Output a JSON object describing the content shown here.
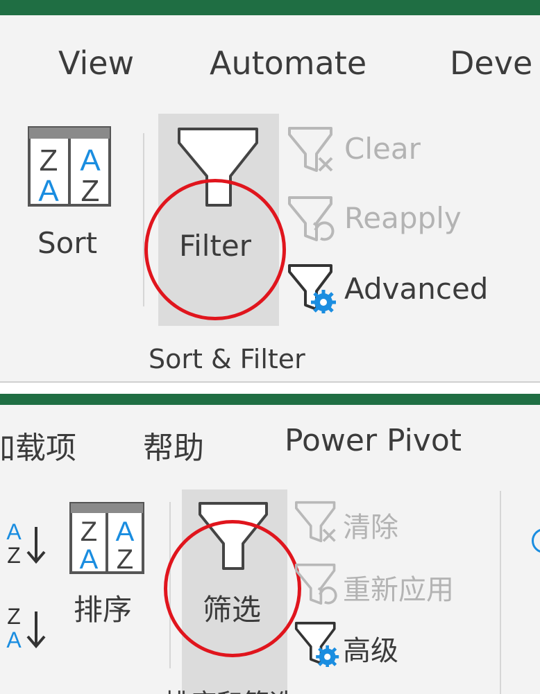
{
  "colors": {
    "excel_green": "#1f6e43",
    "accent_red": "#e0151d",
    "icon_blue": "#1a8de0"
  },
  "english": {
    "tabs": [
      "View",
      "Automate",
      "Deve"
    ],
    "sort_label": "Sort",
    "filter_label": "Filter",
    "clear_label": "Clear",
    "reapply_label": "Reapply",
    "advanced_label": "Advanced",
    "group_label": "Sort & Filter"
  },
  "chinese": {
    "tabs": [
      "加载项",
      "帮助",
      "Power Pivot"
    ],
    "sort_label": "排序",
    "filter_label": "筛选",
    "clear_label": "清除",
    "reapply_label": "重新应用",
    "advanced_label": "高级",
    "group_label": "排序和筛选"
  },
  "icons": [
    "sort-az-icon",
    "filter-funnel-icon",
    "clear-filter-icon",
    "reapply-filter-icon",
    "advanced-filter-icon",
    "sort-ascending-icon",
    "sort-descending-icon"
  ]
}
